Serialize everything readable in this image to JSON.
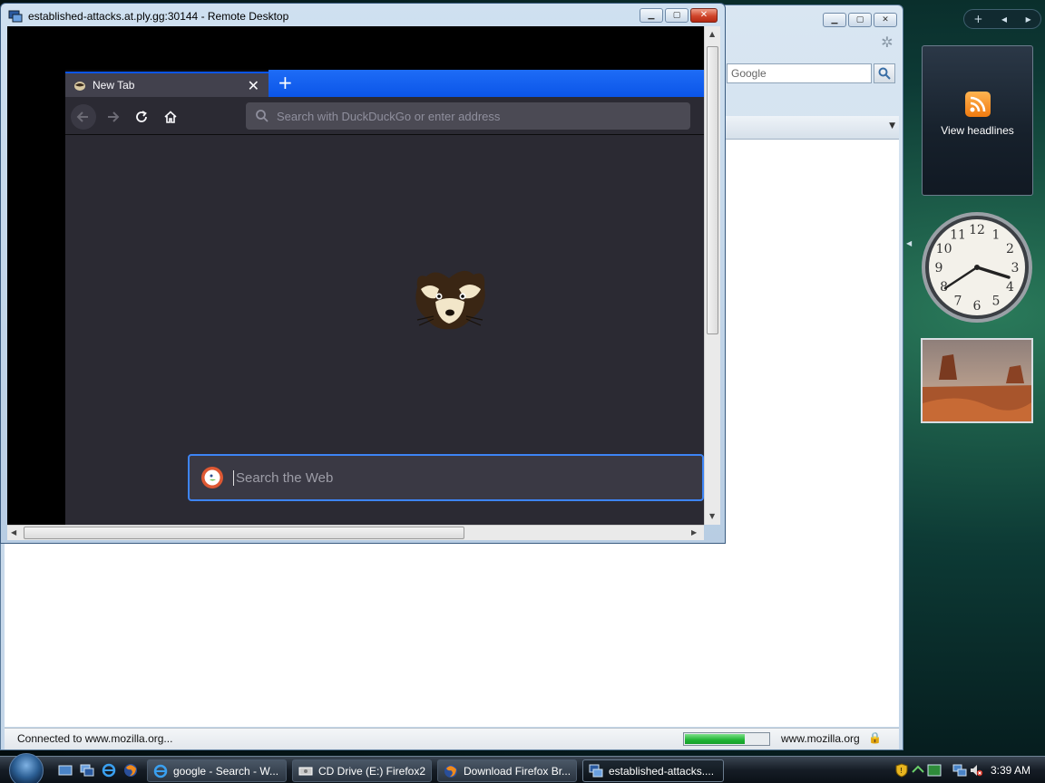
{
  "background_browser": {
    "search_placeholder": "Google",
    "status_text": "Connected to www.mozilla.org...",
    "status_domain": "www.mozilla.org",
    "progress_fraction": 0.72,
    "status_color": "#1fb334"
  },
  "sidebar": {
    "feed_label": "View headlines",
    "clock_numerals": [
      "12",
      "1",
      "2",
      "3",
      "4",
      "5",
      "6",
      "7",
      "8",
      "9",
      "10",
      "11"
    ]
  },
  "remote_desktop": {
    "title": "established-attacks.at.ply.gg:30144 - Remote Desktop",
    "browser": {
      "tab_title": "New Tab",
      "urlbar_placeholder": "Search with DuckDuckGo or enter address",
      "search_placeholder": "Search the Web",
      "accent_color": "#0b55e8"
    }
  },
  "taskbar": {
    "tasks": [
      {
        "label": "google - Search - W..."
      },
      {
        "label": "CD Drive (E:) Firefox2"
      },
      {
        "label": "Download Firefox Br..."
      },
      {
        "label": "established-attacks...."
      }
    ],
    "clock": "3:39 AM"
  }
}
